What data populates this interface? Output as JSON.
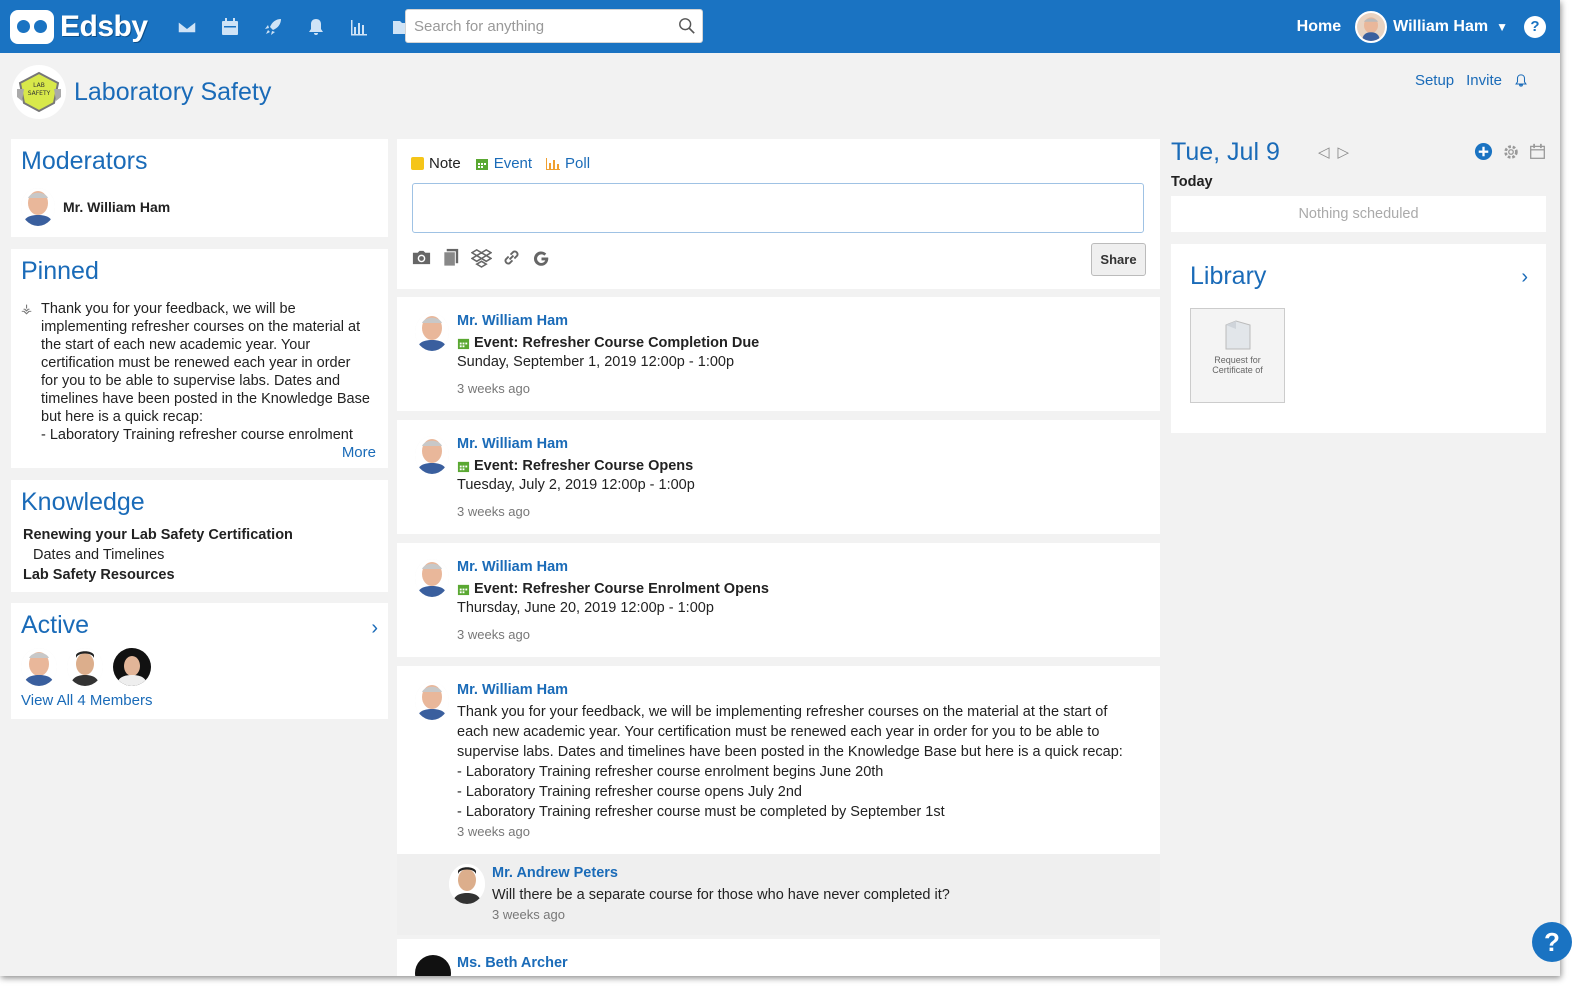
{
  "app": {
    "name": "Edsby"
  },
  "topbar": {
    "icons": [
      "mail-icon",
      "calendar-icon",
      "rocket-icon",
      "bell-icon",
      "chart-icon",
      "folder-icon"
    ],
    "search_placeholder": "Search for anything",
    "home_label": "Home",
    "user_name": "William Ham",
    "help_label": "?"
  },
  "group": {
    "badge_text_1": "LAB",
    "badge_text_2": "SAFETY",
    "title": "Laboratory Safety",
    "setup_label": "Setup",
    "invite_label": "Invite"
  },
  "left": {
    "moderators": {
      "title": "Moderators",
      "name": "Mr. William Ham"
    },
    "pinned": {
      "title": "Pinned",
      "lines": [
        "Thank you for your feedback, we will be",
        "implementing refresher courses on the material at",
        "the start of each new academic year. Your",
        "certification must be renewed each year in order",
        "for you to be able to supervise labs. Dates and",
        "timelines have been posted in the Knowledge Base",
        "but here is a quick recap:",
        "- Laboratory Training refresher course enrolment"
      ],
      "more_label": "More"
    },
    "knowledge": {
      "title": "Knowledge",
      "item1": "Renewing your Lab Safety Certification",
      "item1_sub": "Dates and Timelines",
      "item2": "Lab Safety Resources"
    },
    "active": {
      "title": "Active",
      "view_all": "View All 4 Members"
    }
  },
  "composer": {
    "tab_note": "Note",
    "tab_event": "Event",
    "tab_poll": "Poll",
    "share_label": "Share",
    "note_color": "#f5c518",
    "event_color": "#5aa832",
    "poll_color": "#f0a030"
  },
  "feed": [
    {
      "author": "Mr. William Ham",
      "event_prefix": "Event:",
      "event_title": "Refresher Course Completion Due",
      "time": "Sunday, September 1, 2019 12:00p - 1:00p",
      "ago": "3 weeks ago"
    },
    {
      "author": "Mr. William Ham",
      "event_prefix": "Event:",
      "event_title": "Refresher Course Opens",
      "time": "Tuesday, July 2, 2019 12:00p - 1:00p",
      "ago": "3 weeks ago"
    },
    {
      "author": "Mr. William Ham",
      "event_prefix": "Event:",
      "event_title": "Refresher Course Enrolment Opens",
      "time": "Thursday, June 20, 2019 12:00p - 1:00p",
      "ago": "3 weeks ago"
    },
    {
      "author": "Mr. William Ham",
      "lines": [
        "Thank you for your feedback, we will be implementing refresher courses on the material at the start of",
        "each new academic year. Your certification must be renewed each year in order for you to be able to",
        "supervise labs. Dates and timelines have been posted in the Knowledge Base but here is a quick recap:",
        "- Laboratory Training refresher course enrolment begins June 20th",
        "- Laboratory Training refresher course opens July 2nd",
        "- Laboratory Training refresher course must be completed by September 1st"
      ],
      "ago": "3 weeks ago"
    }
  ],
  "reply": {
    "author": "Mr. Andrew Peters",
    "text": "Will there be a separate course for those who have never completed it?",
    "ago": "3 weeks ago"
  },
  "next_post": {
    "author": "Ms. Beth Archer"
  },
  "calendar": {
    "date": "Tue, Jul 9",
    "today_label": "Today",
    "empty_label": "Nothing scheduled"
  },
  "library": {
    "title": "Library",
    "tile_caption_1": "Request for",
    "tile_caption_2": "Certificate of"
  },
  "colors": {
    "brand": "#1a73c2",
    "link": "#1a6bb8"
  }
}
